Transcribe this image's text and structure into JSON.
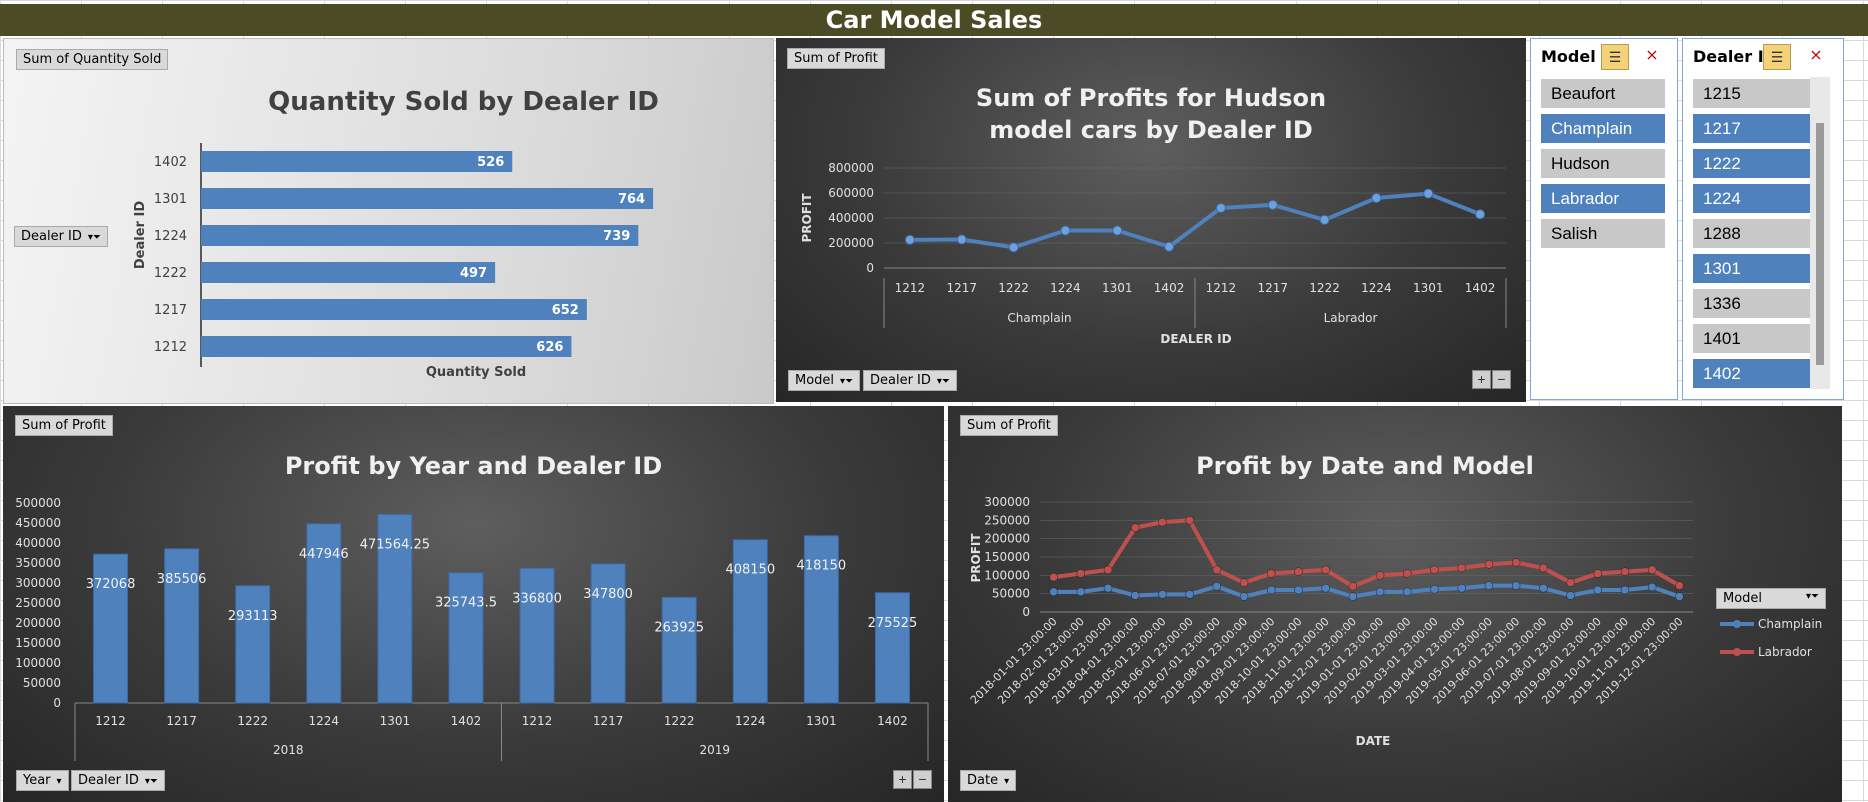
{
  "window": {
    "title": "Car Model Sales"
  },
  "colors": {
    "titlebar": "#4b4b26",
    "bar_blue": "#4f81bd",
    "line_blue": "#4f81bd",
    "line_red": "#c0504d"
  },
  "chart1": {
    "field_value": "Sum of Quantity Sold",
    "field_row": "Dealer ID",
    "chart_data": {
      "type": "bar",
      "orientation": "horizontal",
      "title": "Quantity Sold by Dealer ID",
      "xlabel": "Quantity Sold",
      "ylabel": "Dealer ID",
      "categories": [
        "1212",
        "1217",
        "1222",
        "1224",
        "1301",
        "1402"
      ],
      "values": [
        626,
        652,
        497,
        739,
        764,
        526
      ],
      "xlim": [
        0,
        850
      ]
    }
  },
  "chart2": {
    "field_value": "Sum of Profit",
    "field_filters": [
      "Model",
      "Dealer ID"
    ],
    "chart_data": {
      "type": "line",
      "title": "Sum of Profits for Hudson model cars by Dealer ID",
      "xlabel": "DEALER ID",
      "ylabel": "PROFIT",
      "groups": [
        {
          "name": "Champlain",
          "categories": [
            "1212",
            "1217",
            "1222",
            "1224",
            "1301",
            "1402"
          ]
        },
        {
          "name": "Labrador",
          "categories": [
            "1212",
            "1217",
            "1222",
            "1224",
            "1301",
            "1402"
          ]
        }
      ],
      "values": [
        225000,
        228000,
        165000,
        300000,
        300000,
        170000,
        480000,
        505000,
        385000,
        560000,
        595000,
        430000
      ],
      "yticks": [
        "800000",
        "600000",
        "400000",
        "200000",
        "0"
      ],
      "ylim": [
        0,
        800000
      ]
    }
  },
  "slicer_model": {
    "title": "Model",
    "items": [
      {
        "label": "Beaufort",
        "selected": false
      },
      {
        "label": "Champlain",
        "selected": true
      },
      {
        "label": "Hudson",
        "selected": false
      },
      {
        "label": "Labrador",
        "selected": true
      },
      {
        "label": "Salish",
        "selected": false
      }
    ]
  },
  "slicer_dealer": {
    "title": "Dealer ID",
    "items": [
      {
        "label": "1215",
        "selected": false
      },
      {
        "label": "1217",
        "selected": true
      },
      {
        "label": "1222",
        "selected": true
      },
      {
        "label": "1224",
        "selected": true
      },
      {
        "label": "1288",
        "selected": false
      },
      {
        "label": "1301",
        "selected": true
      },
      {
        "label": "1336",
        "selected": false
      },
      {
        "label": "1401",
        "selected": false
      },
      {
        "label": "1402",
        "selected": true
      }
    ]
  },
  "chart3": {
    "field_value": "Sum of Profit",
    "field_filters": [
      "Year",
      "Dealer ID"
    ],
    "chart_data": {
      "type": "bar",
      "title": "Profit by Year and Dealer ID",
      "groups": [
        {
          "name": "2018",
          "categories": [
            "1212",
            "1217",
            "1222",
            "1224",
            "1301",
            "1402"
          ]
        },
        {
          "name": "2019",
          "categories": [
            "1212",
            "1217",
            "1222",
            "1224",
            "1301",
            "1402"
          ]
        }
      ],
      "values": [
        372068,
        385506,
        293113,
        447946,
        471564.25,
        325743.5,
        336800,
        347800,
        263925,
        408150,
        418150,
        275525
      ],
      "value_labels": [
        "372068",
        "385506",
        "293113",
        "447946",
        "471564.25",
        "325743.5",
        "336800",
        "347800",
        "263925",
        "408150",
        "418150",
        "275525"
      ],
      "yticks": [
        "500000",
        "450000",
        "400000",
        "350000",
        "300000",
        "250000",
        "200000",
        "150000",
        "100000",
        "50000",
        "0"
      ],
      "ylim": [
        0,
        500000
      ]
    }
  },
  "chart4": {
    "field_value": "Sum of Profit",
    "field_filter": "Date",
    "legend_field": "Model",
    "chart_data": {
      "type": "line",
      "title": "Profit by Date and Model",
      "xlabel": "DATE",
      "ylabel": "PROFIT",
      "legend_position": "right",
      "x": [
        "2018-01-01 23:00:00",
        "2018-02-01 23:00:00",
        "2018-03-01 23:00:00",
        "2018-04-01 23:00:00",
        "2018-05-01 23:00:00",
        "2018-06-01 23:00:00",
        "2018-07-01 23:00:00",
        "2018-08-01 23:00:00",
        "2018-09-01 23:00:00",
        "2018-10-01 23:00:00",
        "2018-11-01 23:00:00",
        "2018-12-01 23:00:00",
        "2019-01-01 23:00:00",
        "2019-02-01 23:00:00",
        "2019-03-01 23:00:00",
        "2019-04-01 23:00:00",
        "2019-05-01 23:00:00",
        "2019-06-01 23:00:00",
        "2019-07-01 23:00:00",
        "2019-08-01 23:00:00",
        "2019-09-01 23:00:00",
        "2019-10-01 23:00:00",
        "2019-11-01 23:00:00",
        "2019-12-01 23:00:00"
      ],
      "series": [
        {
          "name": "Champlain",
          "color": "#4f81bd",
          "values": [
            55000,
            55000,
            65000,
            45000,
            48000,
            48000,
            70000,
            42000,
            60000,
            60000,
            65000,
            42000,
            55000,
            55000,
            62000,
            65000,
            72000,
            72000,
            65000,
            45000,
            60000,
            60000,
            68000,
            42000
          ]
        },
        {
          "name": "Labrador",
          "color": "#c0504d",
          "values": [
            95000,
            105000,
            115000,
            230000,
            245000,
            250000,
            115000,
            80000,
            105000,
            110000,
            115000,
            70000,
            100000,
            105000,
            115000,
            120000,
            130000,
            135000,
            120000,
            80000,
            105000,
            110000,
            115000,
            72000
          ]
        }
      ],
      "yticks": [
        "300000",
        "250000",
        "200000",
        "150000",
        "100000",
        "50000",
        "0"
      ],
      "ylim": [
        0,
        300000
      ]
    }
  }
}
